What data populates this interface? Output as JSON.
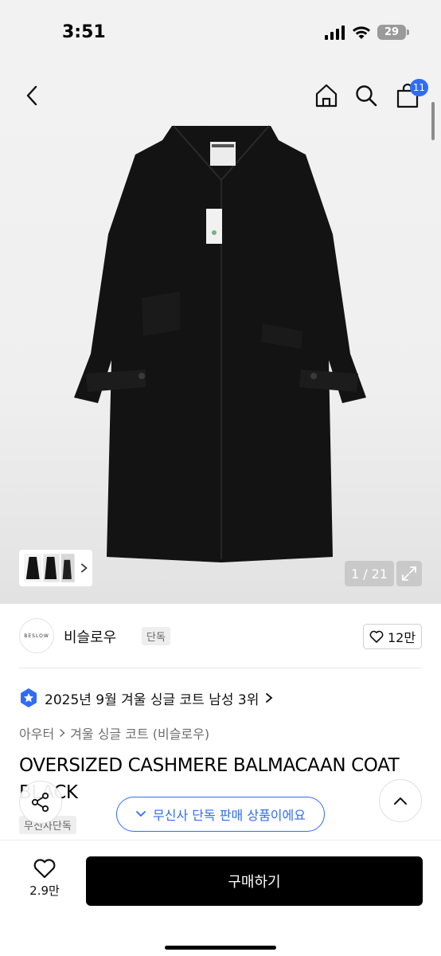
{
  "status_bar": {
    "time": "3:51",
    "battery": "29"
  },
  "header": {
    "cart_count": "11"
  },
  "hero": {
    "image_counter": "1 / 21"
  },
  "brand": {
    "logo_text": "BESLOW",
    "name": "비슬로우",
    "tag": "단독",
    "likes": "12만"
  },
  "ranking": {
    "text": "2025년 9월 겨울 싱글 코트 남성 3위"
  },
  "breadcrumb": {
    "level1": "아우터",
    "level2": "겨울 싱글 코트 (비슬로우)"
  },
  "product": {
    "title": "OVERSIZED CASHMERE BALMACAAN COAT BLACK",
    "exclusive_tag": "무신사단독"
  },
  "floating": {
    "exclusive_pill": "무신사 단독 판매 상품이에요"
  },
  "bottom_bar": {
    "wish_count": "2.9만",
    "buy_label": "구매하기"
  },
  "colors": {
    "accent": "#2f6cf6",
    "buy_button": "#000000"
  }
}
